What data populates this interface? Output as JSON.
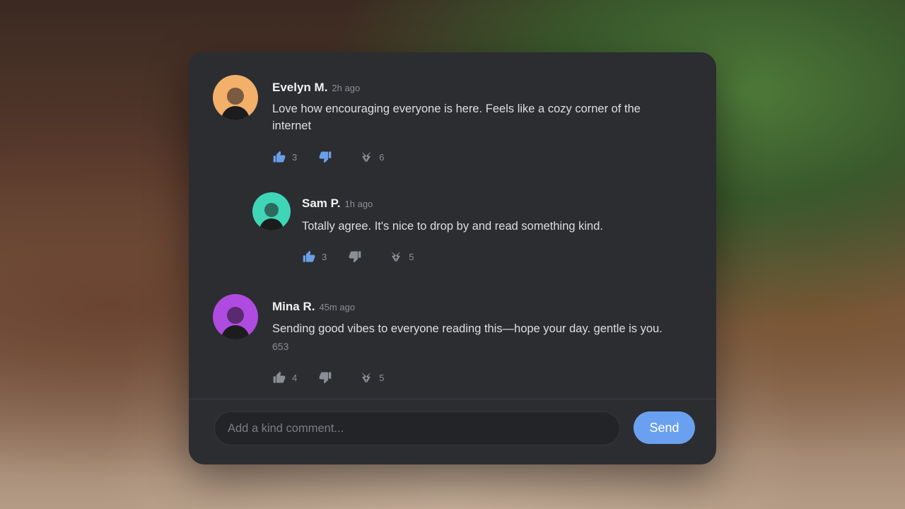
{
  "comments": [
    {
      "author": "Evelyn M.",
      "time": "2h ago",
      "text": "Love how encouraging everyone is here. Feels like a cozy corner of the internet",
      "likes": "3",
      "shares": "6",
      "avatar_color": "#f2b06b",
      "avatar_head_color": "#7a5a40"
    },
    {
      "author": "Sam P.",
      "time": "1h ago",
      "text": "Totally agree. It's nice to drop by and read something kind.",
      "likes": "3",
      "shares": "5",
      "avatar_color": "#3fd6b8",
      "avatar_head_color": "#2e6a5c"
    },
    {
      "author": "Mina R.",
      "time": "45m ago",
      "text": "Sending good vibes to everyone reading this—hope your day. gentle is you.",
      "extra": "653",
      "likes": "4",
      "shares": "5",
      "avatar_color": "#b04be0",
      "avatar_head_color": "#5a2a70"
    }
  ],
  "composer": {
    "placeholder": "Add a kind comment...",
    "send_label": "Send"
  },
  "colors": {
    "panel": "#2b2d31",
    "accent": "#6aa0f0",
    "icon_active": "#6a9ee8",
    "icon_muted": "#8b8e94"
  }
}
